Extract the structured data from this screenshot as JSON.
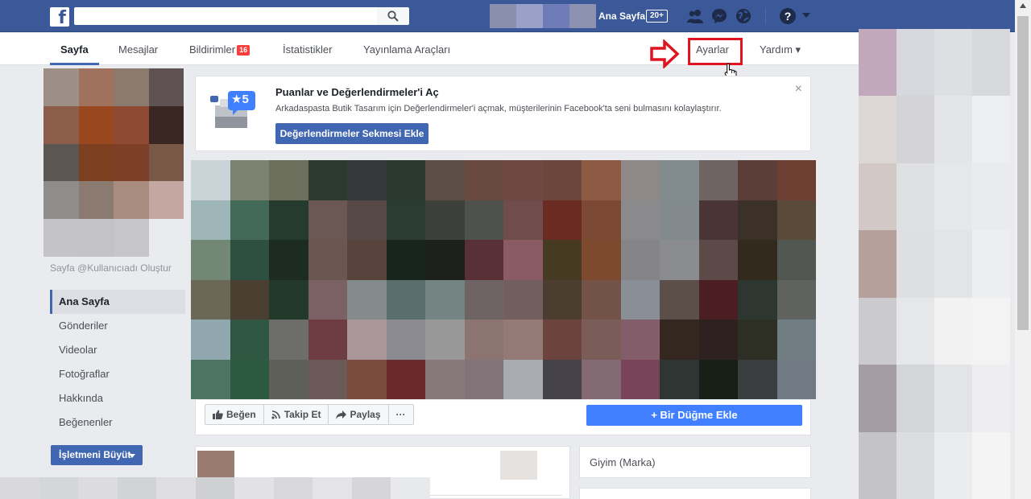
{
  "topbar": {
    "search_placeholder": "",
    "home_label": "Ana Sayfa",
    "home_badge": "20+",
    "logo_letter": "f"
  },
  "tabs": {
    "page": "Sayfa",
    "messages": "Mesajlar",
    "notifications": "Bildirimler",
    "notifications_count": "16",
    "insights": "İstatistikler",
    "publishing_tools": "Yayınlama Araçları",
    "settings": "Ayarlar",
    "help": "Yardım ▾"
  },
  "left": {
    "username_link": "Sayfa @Kullanıcıadı Oluştur",
    "nav": [
      "Ana Sayfa",
      "Gönderiler",
      "Videolar",
      "Fotoğraflar",
      "Hakkında",
      "Beğenenler"
    ],
    "grow_button": "İşletmeni Büyüt"
  },
  "reviews_card": {
    "badge": "★5",
    "title": "Puanlar ve Değerlendirmeler'i Aç",
    "description": "Arkadaspasta Butik Tasarım için Değerlendirmeler'i açmak, müşterilerinin Facebook'ta seni bulmasını kolaylaştırır.",
    "button": "Değerlendirmeler Sekmesi Ekle",
    "close": "×"
  },
  "actions": {
    "like": "Beğen",
    "follow": "Takip Et",
    "share": "Paylaş",
    "more": "···",
    "add_button": "+ Bir Düğme Ekle"
  },
  "info": {
    "category": "Giyim (Marka)"
  },
  "colors": {
    "brand_blue": "#3b5998",
    "button_blue": "#4267b2",
    "add_button_blue": "#4080ff",
    "highlight_red": "#e0141e",
    "badge_red": "#fa3e3e"
  },
  "icons": {
    "search": "search-icon",
    "friends": "friend-requests-icon",
    "messenger": "messenger-icon",
    "globe": "notifications-globe-icon",
    "help": "help-icon",
    "arrow": "red-arrow-icon",
    "cursor": "hand-cursor-icon",
    "like": "thumbs-up-icon",
    "follow": "rss-icon",
    "share": "share-arrow-icon"
  }
}
